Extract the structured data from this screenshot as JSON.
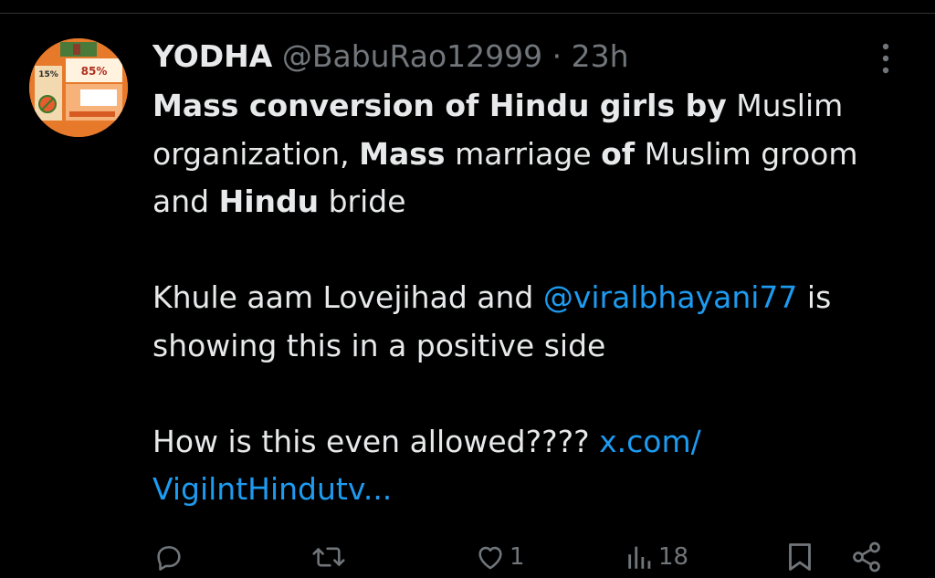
{
  "tweet": {
    "author_name": "YODHA",
    "author_handle": "@BabuRao12999",
    "separator": "·",
    "time": "23h",
    "avatar": {
      "stat_left": "15%",
      "stat_right": "85%"
    },
    "body": {
      "p1": [
        {
          "text": "Mass conversion of Hindu girls by",
          "bold": true
        },
        {
          "text": " Muslim organization, ",
          "bold": false
        },
        {
          "text": "Mass",
          "bold": true
        },
        {
          "text": " marriage ",
          "bold": false
        },
        {
          "text": "of",
          "bold": true
        },
        {
          "text": " Muslim groom and ",
          "bold": false
        },
        {
          "text": "Hindu",
          "bold": true
        },
        {
          "text": " bride",
          "bold": false
        }
      ],
      "p2_pre": "Khule aam Lovejihad and ",
      "p2_mention": "@viralbhayani77",
      "p2_post": " is showing this in a positive side",
      "p3_pre": "How is this even allowed???? ",
      "p3_link": "x.com/ VigilntHindutv..."
    },
    "actions": {
      "reply_count": "",
      "retweet_count": "",
      "like_count": "1",
      "views_count": "18"
    }
  },
  "icons": {
    "more": "more-vertical-icon",
    "reply": "reply-icon",
    "retweet": "retweet-icon",
    "like": "heart-icon",
    "views": "views-icon",
    "bookmark": "bookmark-icon",
    "share": "share-icon"
  },
  "colors": {
    "background": "#000000",
    "text": "#e7e9ea",
    "secondary": "#71767b",
    "link": "#1d9bf0",
    "avatar_bg": "#e7792b"
  }
}
